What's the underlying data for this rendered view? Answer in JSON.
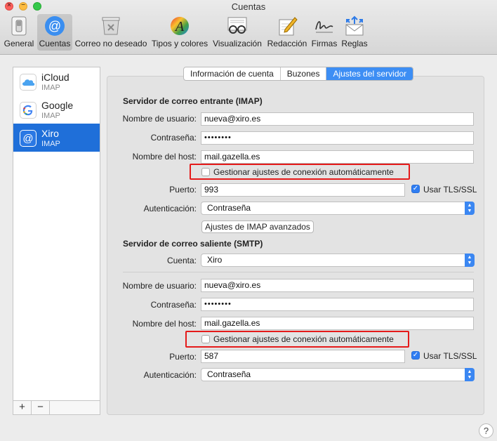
{
  "window": {
    "title": "Cuentas"
  },
  "toolbar": {
    "items": [
      {
        "label": "General",
        "icon": "general-switch-icon"
      },
      {
        "label": "Cuentas",
        "icon": "at-sign-icon"
      },
      {
        "label": "Correo no deseado",
        "icon": "junk-bin-icon"
      },
      {
        "label": "Tipos y colores",
        "icon": "fonts-colors-icon"
      },
      {
        "label": "Visualización",
        "icon": "glasses-icon"
      },
      {
        "label": "Redacción",
        "icon": "pencil-pad-icon"
      },
      {
        "label": "Firmas",
        "icon": "signature-icon"
      },
      {
        "label": "Reglas",
        "icon": "rules-envelope-icon"
      }
    ]
  },
  "accounts": [
    {
      "name": "iCloud",
      "type": "IMAP",
      "icon": "icloud-icon",
      "color": "#4aa3f0"
    },
    {
      "name": "Google",
      "type": "IMAP",
      "icon": "google-icon",
      "color": "#ffffff"
    },
    {
      "name": "Xiro",
      "type": "IMAP",
      "icon": "at-sign-icon",
      "color": "#2a78e4"
    }
  ],
  "list_footer": {
    "add": "+",
    "remove": "−"
  },
  "tabs": [
    {
      "label": "Información de cuenta"
    },
    {
      "label": "Buzones"
    },
    {
      "label": "Ajustes del servidor"
    }
  ],
  "incoming": {
    "title": "Servidor de correo entrante (IMAP)",
    "username_label": "Nombre de usuario:",
    "username": "nueva@xiro.es",
    "password_label": "Contraseña:",
    "password": "••••••••",
    "host_label": "Nombre del host:",
    "host": "mail.gazella.es",
    "auto_manage_label": "Gestionar ajustes de conexión automáticamente",
    "port_label": "Puerto:",
    "port": "993",
    "tls_label": "Usar TLS/SSL",
    "auth_label": "Autenticación:",
    "auth": "Contraseña",
    "advanced_button": "Ajustes de IMAP avanzados"
  },
  "outgoing": {
    "title": "Servidor de correo saliente (SMTP)",
    "account_label": "Cuenta:",
    "account": "Xiro",
    "username_label": "Nombre de usuario:",
    "username": "nueva@xiro.es",
    "password_label": "Contraseña:",
    "password": "••••••••",
    "host_label": "Nombre del host:",
    "host": "mail.gazella.es",
    "auto_manage_label": "Gestionar ajustes de conexión automáticamente",
    "port_label": "Puerto:",
    "port": "587",
    "tls_label": "Usar TLS/SSL",
    "auth_label": "Autenticación:",
    "auth": "Contraseña"
  },
  "help": {
    "label": "?"
  },
  "colors": {
    "accent": "#3d8ef4",
    "highlight_box": "#e51a1a"
  }
}
